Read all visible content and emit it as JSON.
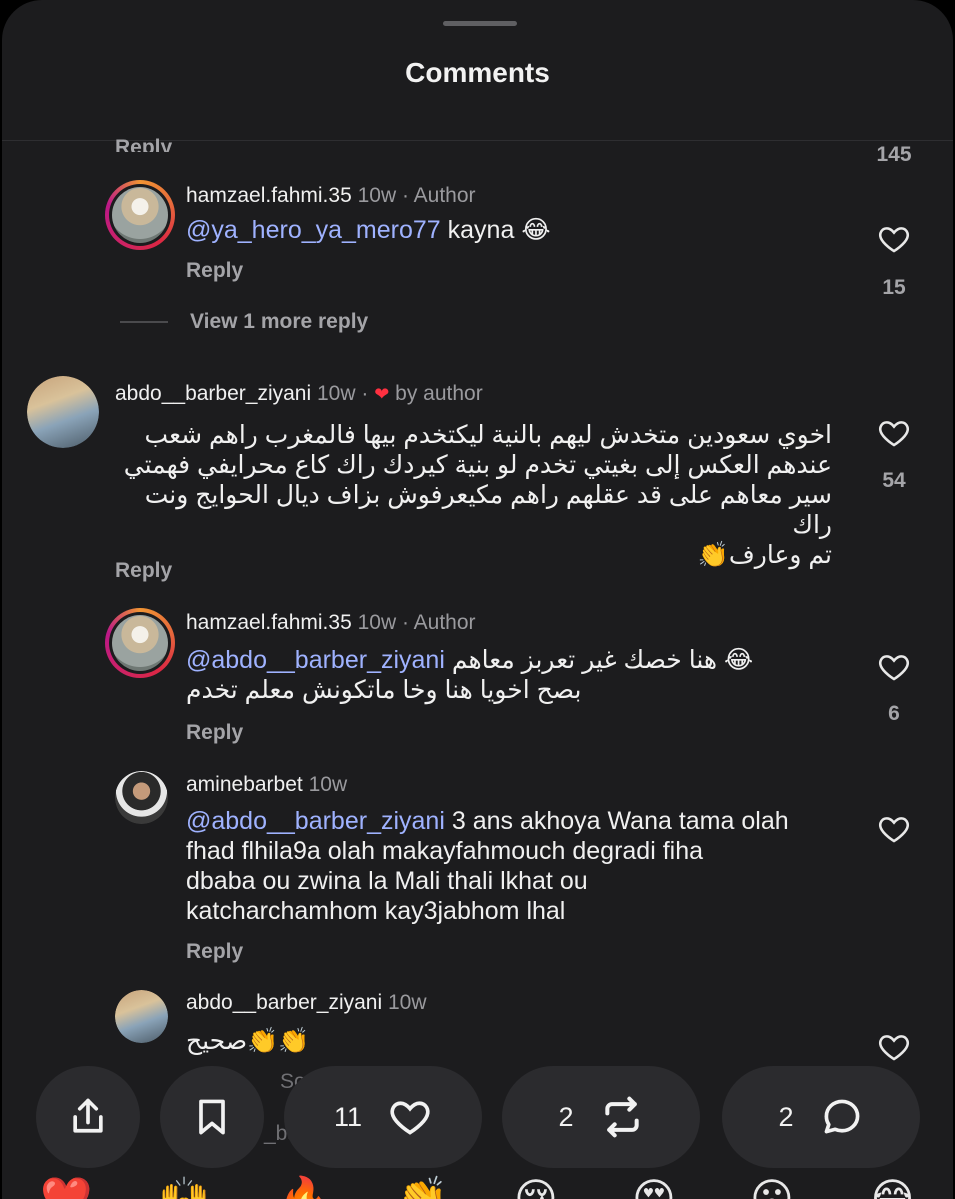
{
  "header": {
    "title": "Comments"
  },
  "top_partial": {
    "reply_label": "Reply",
    "like_count": "145"
  },
  "comments": [
    {
      "username": "hamzael.fahmi.35",
      "time": "10w",
      "tag": "· Author",
      "mention": "@ya_hero_ya_mero77",
      "text": "kayna 😂",
      "reply_label": "Reply",
      "like_count": "15"
    },
    {
      "username": "abdo__barber_ziyani",
      "time": "10w",
      "separator": "·",
      "tag": "by author",
      "lines": [
        "اخوي سعودين متخدش ليهم بالنية ليكتخدم بيها فالمغرب راهم شعب",
        "عندهم العكس إلى بغيتي تخدم لو بنية كيردك راك كاع محرايفي فهمتي",
        "سير معاهم على قد عقلهم راهم مكيعرفوش بزاف ديال الحوايج ونت راك",
        "تم وعارف👏"
      ],
      "reply_label": "Reply",
      "like_count": "54"
    },
    {
      "username": "hamzael.fahmi.35",
      "time": "10w",
      "tag": "· Author",
      "mention": "@abdo__barber_ziyani",
      "text": "😂 هنا خصك غير تعربز معاهم",
      "text2": "بصح اخويا هنا وخا ماتكونش معلم تخدم",
      "reply_label": "Reply",
      "like_count": "6"
    },
    {
      "username": "aminebarbet",
      "time": "10w",
      "mention": "@abdo__barber_ziyani",
      "lines": [
        "3 ans akhoya Wana tama olah",
        "fhad flhila9a olah makayfahmouch degradi fiha",
        "dbaba ou zwina la Mali thali lkhat ou",
        "katcharchamhom kay3jabhom lhal"
      ],
      "reply_label": "Reply"
    },
    {
      "username": "abdo__barber_ziyani",
      "time": "10w",
      "text": "👏👏صحيح",
      "partial_a": "So",
      "partial_b": "_ba"
    }
  ],
  "view_more": "View 1 more reply",
  "action_bar": {
    "share_icon": "share-icon",
    "bookmark_icon": "bookmark-icon",
    "likes": "11",
    "reposts": "2",
    "comments": "2"
  },
  "emoji_reactions": [
    "❤️",
    "🙌",
    "🔥",
    "👏",
    "😢",
    "😍",
    "😮",
    "😂"
  ],
  "colors": {
    "background": "#1c1c1e",
    "mention": "#9fb2ff",
    "muted": "#a4a4a8",
    "heart_red": "#ff3040",
    "pill": "#2b2b2e"
  }
}
